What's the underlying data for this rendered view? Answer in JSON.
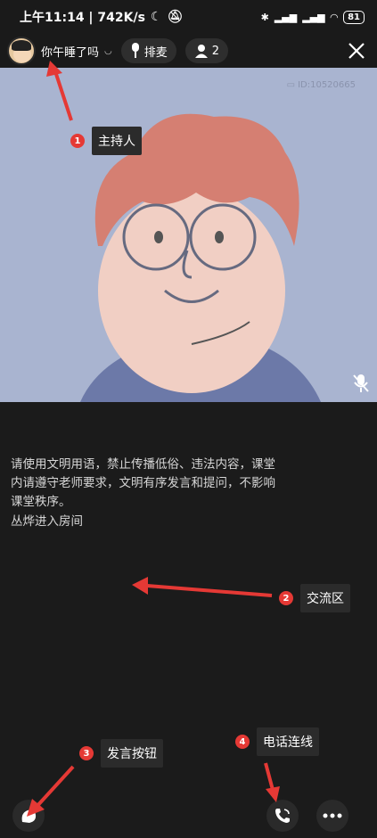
{
  "status_bar": {
    "time_speed": "上午11:14 | 742K/s",
    "battery": "81"
  },
  "top_bar": {
    "host_name": "你午睡了吗",
    "queue_label": "排麦",
    "member_count": "2"
  },
  "video": {
    "room_id": "ID:10520665"
  },
  "chat": {
    "notice": "请使用文明用语，禁止传播低俗、违法内容，课堂内请遵守老师要求，文明有序发言和提问，不影响课堂秩序。",
    "join_message": "丛烨进入房间"
  },
  "annotations": [
    {
      "num": "1",
      "label": "主持人"
    },
    {
      "num": "2",
      "label": "交流区"
    },
    {
      "num": "3",
      "label": "发言按钮"
    },
    {
      "num": "4",
      "label": "电话连线"
    }
  ],
  "colors": {
    "background": "#1a1a1a",
    "video_bg": "#a9b4d0",
    "callout_red": "#e53935"
  }
}
